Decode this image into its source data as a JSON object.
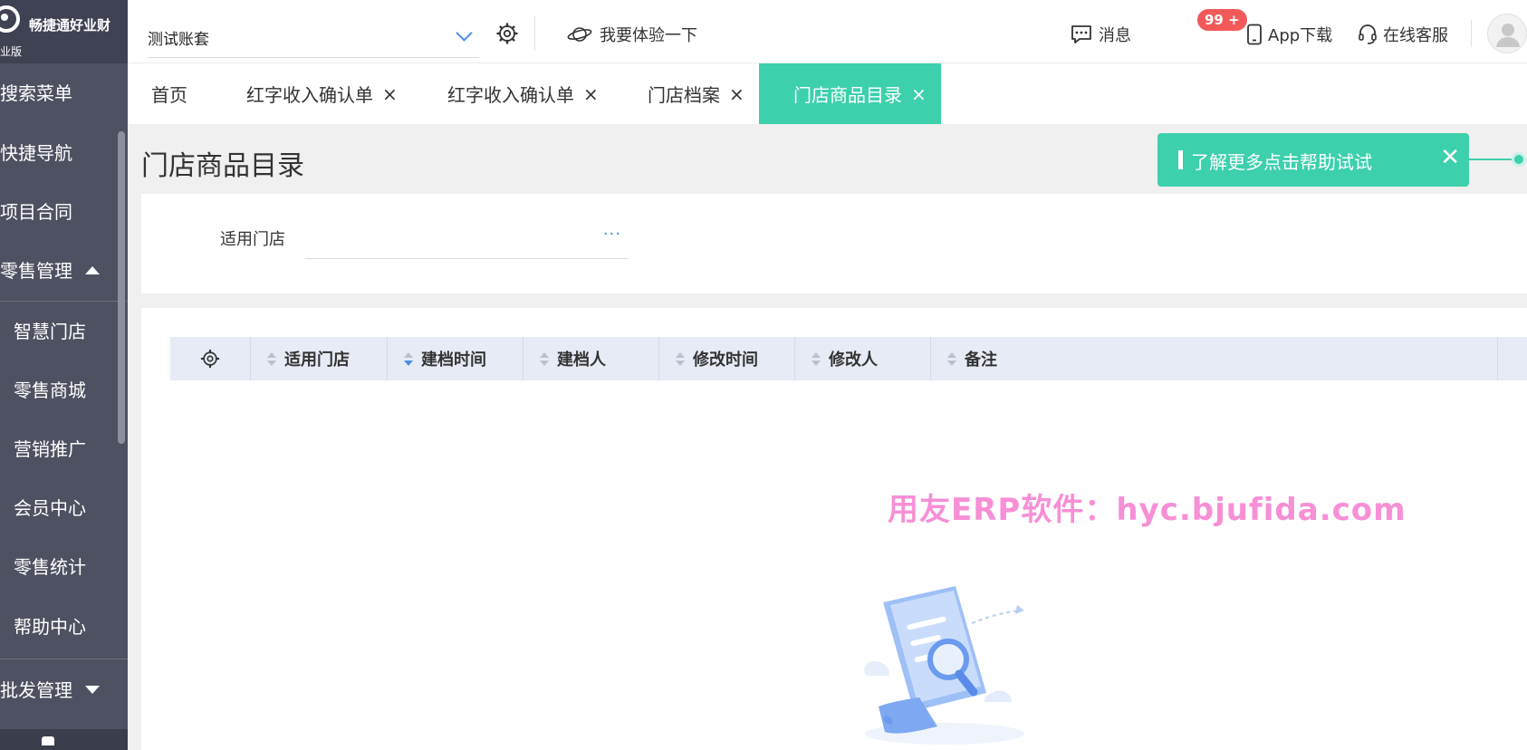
{
  "sidebar": {
    "brand_name": "畅捷通好业财",
    "edition": "业版",
    "items": [
      {
        "label": "搜索菜单"
      },
      {
        "label": "快捷导航"
      },
      {
        "label": "项目合同"
      },
      {
        "label": "零售管理"
      },
      {
        "label": "智慧门店"
      },
      {
        "label": "零售商城"
      },
      {
        "label": "营销推广"
      },
      {
        "label": "会员中心"
      },
      {
        "label": "零售统计"
      },
      {
        "label": "帮助中心"
      },
      {
        "label": "批发管理"
      }
    ]
  },
  "topbar": {
    "account": "测试账套",
    "try_label": "我要体验一下",
    "messages_label": "消息",
    "messages_badge": "99 +",
    "app_download_label": "App下载",
    "online_service_label": "在线客服"
  },
  "tabs": [
    {
      "label": "首页",
      "closable": false
    },
    {
      "label": "红字收入确认单",
      "closable": true
    },
    {
      "label": "红字收入确认单",
      "closable": true
    },
    {
      "label": "门店档案",
      "closable": true
    },
    {
      "label": "门店商品目录",
      "closable": true,
      "active": true
    }
  ],
  "tab_close_glyph": "×",
  "page": {
    "title": "门店商品目录",
    "help_banner": "了解更多点击帮助试试",
    "help_close": "✕"
  },
  "filter": {
    "store_label": "适用门店",
    "store_value": "",
    "more_glyph": "···"
  },
  "grid": {
    "columns": [
      {
        "label": "适用门店"
      },
      {
        "label": "建档时间"
      },
      {
        "label": "建档人"
      },
      {
        "label": "修改时间"
      },
      {
        "label": "修改人"
      },
      {
        "label": "备注"
      }
    ]
  },
  "watermark": "用友ERP软件：hyc.bjufida.com",
  "colors": {
    "accent": "#3dd0ad",
    "sidebar_bg": "#4e5161",
    "badge": "#f25a5a",
    "link_blue": "#4a90e2",
    "watermark": "#f78fd6"
  }
}
